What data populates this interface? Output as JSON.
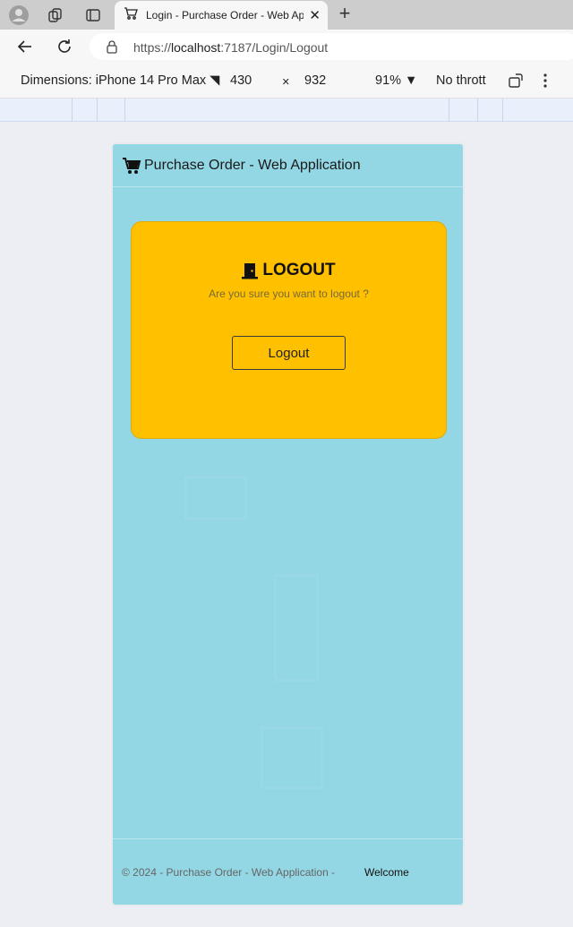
{
  "browser": {
    "tab_title": "Login - Purchase Order - Web Application",
    "url_prefix": "https://",
    "url_host": "localhost",
    "url_rest": ":7187/Login/Logout"
  },
  "devtools": {
    "dimensions_label": "Dimensions: iPhone 14 Pro Max",
    "width": "430",
    "times": "×",
    "height": "932",
    "zoom": "91%",
    "throttle": "No thrott"
  },
  "app": {
    "title": "Purchase Order - Web Application",
    "card": {
      "heading": "LOGOUT",
      "subtitle": "Are you sure you want to logout ?",
      "button_label": "Logout"
    },
    "footer": {
      "copyright": "© 2024 - Purchase Order - Web Application -",
      "link": "Welcome"
    }
  },
  "colors": {
    "app_background": "#93d7e4",
    "card_background": "#ffc000"
  },
  "icons": {
    "profile": "profile-icon",
    "workspaces": "workspaces-icon",
    "tab_actions": "tab-actions-icon",
    "tab_favicon": "cart-icon",
    "back": "back-arrow-icon",
    "refresh": "refresh-icon",
    "lock": "lock-icon",
    "app_logo": "shopping-cart-icon",
    "logout": "door-icon"
  }
}
